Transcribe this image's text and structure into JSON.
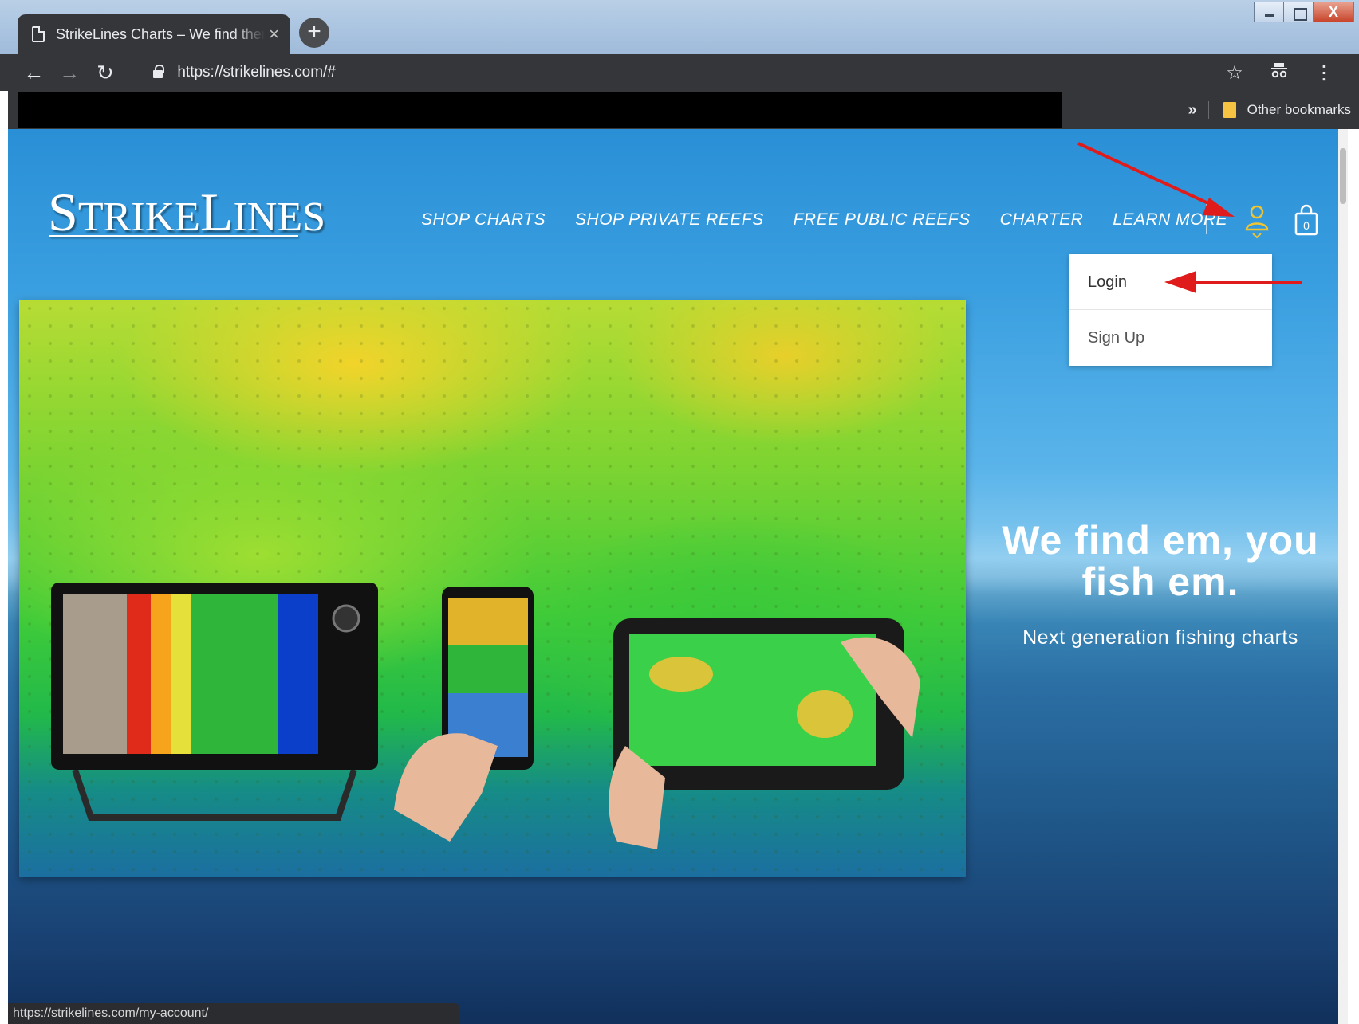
{
  "browser": {
    "tab_title": "StrikeLines Charts – We find them, you fish them",
    "tab_close": "×",
    "new_tab": "+",
    "url": "https://strikelines.com/#",
    "bookmarks_overflow": "»",
    "other_bookmarks": "Other bookmarks",
    "status_url": "https://strikelines.com/my-account/",
    "window_close": "X"
  },
  "site": {
    "logo_big1": "S",
    "logo_small1": "TRIKE",
    "logo_big2": "L",
    "logo_small2": "INES",
    "nav": [
      "SHOP CHARTS",
      "SHOP PRIVATE REEFS",
      "FREE PUBLIC REEFS",
      "CHARTER",
      "LEARN MORE"
    ],
    "cart_count": "0",
    "account_menu": [
      "Login",
      "Sign Up"
    ],
    "hero_title_line1": "We find em, you",
    "hero_title_line2": "fish em.",
    "hero_subtitle": "Next generation fishing charts"
  },
  "colors": {
    "accent_yellow": "#f2c530",
    "annotation_red": "#e01b1b",
    "browser_chrome": "#35363a"
  }
}
